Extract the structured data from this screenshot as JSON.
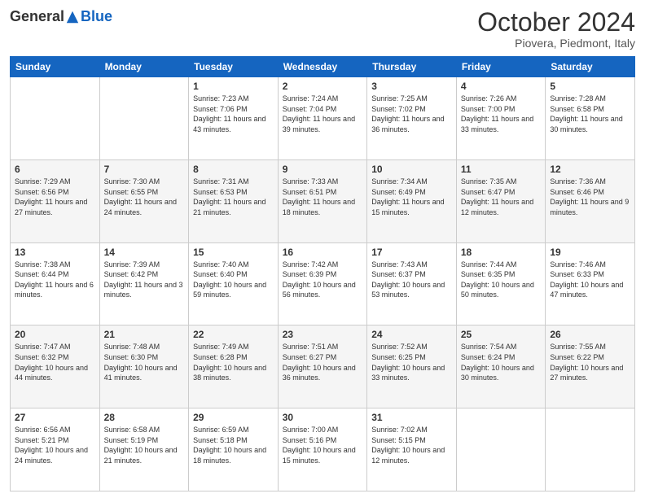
{
  "header": {
    "logo": {
      "general": "General",
      "blue": "Blue"
    },
    "title": "October 2024",
    "subtitle": "Piovera, Piedmont, Italy"
  },
  "days_of_week": [
    "Sunday",
    "Monday",
    "Tuesday",
    "Wednesday",
    "Thursday",
    "Friday",
    "Saturday"
  ],
  "weeks": [
    [
      null,
      null,
      {
        "day": "1",
        "sunrise": "Sunrise: 7:23 AM",
        "sunset": "Sunset: 7:06 PM",
        "daylight": "Daylight: 11 hours and 43 minutes."
      },
      {
        "day": "2",
        "sunrise": "Sunrise: 7:24 AM",
        "sunset": "Sunset: 7:04 PM",
        "daylight": "Daylight: 11 hours and 39 minutes."
      },
      {
        "day": "3",
        "sunrise": "Sunrise: 7:25 AM",
        "sunset": "Sunset: 7:02 PM",
        "daylight": "Daylight: 11 hours and 36 minutes."
      },
      {
        "day": "4",
        "sunrise": "Sunrise: 7:26 AM",
        "sunset": "Sunset: 7:00 PM",
        "daylight": "Daylight: 11 hours and 33 minutes."
      },
      {
        "day": "5",
        "sunrise": "Sunrise: 7:28 AM",
        "sunset": "Sunset: 6:58 PM",
        "daylight": "Daylight: 11 hours and 30 minutes."
      }
    ],
    [
      {
        "day": "6",
        "sunrise": "Sunrise: 7:29 AM",
        "sunset": "Sunset: 6:56 PM",
        "daylight": "Daylight: 11 hours and 27 minutes."
      },
      {
        "day": "7",
        "sunrise": "Sunrise: 7:30 AM",
        "sunset": "Sunset: 6:55 PM",
        "daylight": "Daylight: 11 hours and 24 minutes."
      },
      {
        "day": "8",
        "sunrise": "Sunrise: 7:31 AM",
        "sunset": "Sunset: 6:53 PM",
        "daylight": "Daylight: 11 hours and 21 minutes."
      },
      {
        "day": "9",
        "sunrise": "Sunrise: 7:33 AM",
        "sunset": "Sunset: 6:51 PM",
        "daylight": "Daylight: 11 hours and 18 minutes."
      },
      {
        "day": "10",
        "sunrise": "Sunrise: 7:34 AM",
        "sunset": "Sunset: 6:49 PM",
        "daylight": "Daylight: 11 hours and 15 minutes."
      },
      {
        "day": "11",
        "sunrise": "Sunrise: 7:35 AM",
        "sunset": "Sunset: 6:47 PM",
        "daylight": "Daylight: 11 hours and 12 minutes."
      },
      {
        "day": "12",
        "sunrise": "Sunrise: 7:36 AM",
        "sunset": "Sunset: 6:46 PM",
        "daylight": "Daylight: 11 hours and 9 minutes."
      }
    ],
    [
      {
        "day": "13",
        "sunrise": "Sunrise: 7:38 AM",
        "sunset": "Sunset: 6:44 PM",
        "daylight": "Daylight: 11 hours and 6 minutes."
      },
      {
        "day": "14",
        "sunrise": "Sunrise: 7:39 AM",
        "sunset": "Sunset: 6:42 PM",
        "daylight": "Daylight: 11 hours and 3 minutes."
      },
      {
        "day": "15",
        "sunrise": "Sunrise: 7:40 AM",
        "sunset": "Sunset: 6:40 PM",
        "daylight": "Daylight: 10 hours and 59 minutes."
      },
      {
        "day": "16",
        "sunrise": "Sunrise: 7:42 AM",
        "sunset": "Sunset: 6:39 PM",
        "daylight": "Daylight: 10 hours and 56 minutes."
      },
      {
        "day": "17",
        "sunrise": "Sunrise: 7:43 AM",
        "sunset": "Sunset: 6:37 PM",
        "daylight": "Daylight: 10 hours and 53 minutes."
      },
      {
        "day": "18",
        "sunrise": "Sunrise: 7:44 AM",
        "sunset": "Sunset: 6:35 PM",
        "daylight": "Daylight: 10 hours and 50 minutes."
      },
      {
        "day": "19",
        "sunrise": "Sunrise: 7:46 AM",
        "sunset": "Sunset: 6:33 PM",
        "daylight": "Daylight: 10 hours and 47 minutes."
      }
    ],
    [
      {
        "day": "20",
        "sunrise": "Sunrise: 7:47 AM",
        "sunset": "Sunset: 6:32 PM",
        "daylight": "Daylight: 10 hours and 44 minutes."
      },
      {
        "day": "21",
        "sunrise": "Sunrise: 7:48 AM",
        "sunset": "Sunset: 6:30 PM",
        "daylight": "Daylight: 10 hours and 41 minutes."
      },
      {
        "day": "22",
        "sunrise": "Sunrise: 7:49 AM",
        "sunset": "Sunset: 6:28 PM",
        "daylight": "Daylight: 10 hours and 38 minutes."
      },
      {
        "day": "23",
        "sunrise": "Sunrise: 7:51 AM",
        "sunset": "Sunset: 6:27 PM",
        "daylight": "Daylight: 10 hours and 36 minutes."
      },
      {
        "day": "24",
        "sunrise": "Sunrise: 7:52 AM",
        "sunset": "Sunset: 6:25 PM",
        "daylight": "Daylight: 10 hours and 33 minutes."
      },
      {
        "day": "25",
        "sunrise": "Sunrise: 7:54 AM",
        "sunset": "Sunset: 6:24 PM",
        "daylight": "Daylight: 10 hours and 30 minutes."
      },
      {
        "day": "26",
        "sunrise": "Sunrise: 7:55 AM",
        "sunset": "Sunset: 6:22 PM",
        "daylight": "Daylight: 10 hours and 27 minutes."
      }
    ],
    [
      {
        "day": "27",
        "sunrise": "Sunrise: 6:56 AM",
        "sunset": "Sunset: 5:21 PM",
        "daylight": "Daylight: 10 hours and 24 minutes."
      },
      {
        "day": "28",
        "sunrise": "Sunrise: 6:58 AM",
        "sunset": "Sunset: 5:19 PM",
        "daylight": "Daylight: 10 hours and 21 minutes."
      },
      {
        "day": "29",
        "sunrise": "Sunrise: 6:59 AM",
        "sunset": "Sunset: 5:18 PM",
        "daylight": "Daylight: 10 hours and 18 minutes."
      },
      {
        "day": "30",
        "sunrise": "Sunrise: 7:00 AM",
        "sunset": "Sunset: 5:16 PM",
        "daylight": "Daylight: 10 hours and 15 minutes."
      },
      {
        "day": "31",
        "sunrise": "Sunrise: 7:02 AM",
        "sunset": "Sunset: 5:15 PM",
        "daylight": "Daylight: 10 hours and 12 minutes."
      },
      null,
      null
    ]
  ]
}
